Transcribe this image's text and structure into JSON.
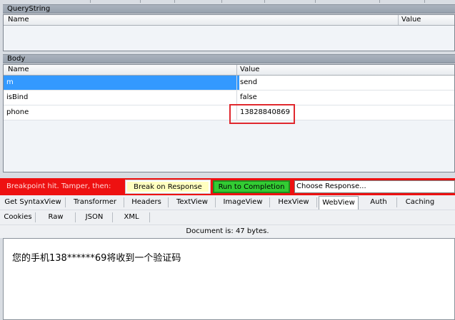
{
  "querystring": {
    "title": "QueryString",
    "columns": [
      "Name",
      "Value"
    ]
  },
  "body": {
    "title": "Body",
    "columns": [
      "Name",
      "Value"
    ],
    "rows": [
      {
        "name": "m",
        "value": "send"
      },
      {
        "name": "isBind",
        "value": "false"
      },
      {
        "name": "phone",
        "value": "13828840869"
      }
    ]
  },
  "breakpoint": {
    "message": "Breakpoint hit. Tamper, then:",
    "break_on_response": "Break on Response",
    "run_to_completion": "Run to Completion",
    "choose_response": "Choose Response..."
  },
  "response_tabs": {
    "row1": [
      "Get SyntaxView",
      "Transformer",
      "Headers",
      "TextView",
      "ImageView",
      "HexView",
      "WebView",
      "Auth",
      "Caching"
    ],
    "row2": [
      "Cookies",
      "Raw",
      "JSON",
      "XML"
    ],
    "active": "WebView"
  },
  "document_info": "Document is: 47 bytes.",
  "webview_content": "您的手机138******69将收到一个验证码",
  "colors": {
    "breakpoint_bar": "#ee1111",
    "run_button": "#33cc33",
    "break_button": "#ffffc0",
    "selection": "#3399ff",
    "highlight_box": "#e0282e"
  }
}
